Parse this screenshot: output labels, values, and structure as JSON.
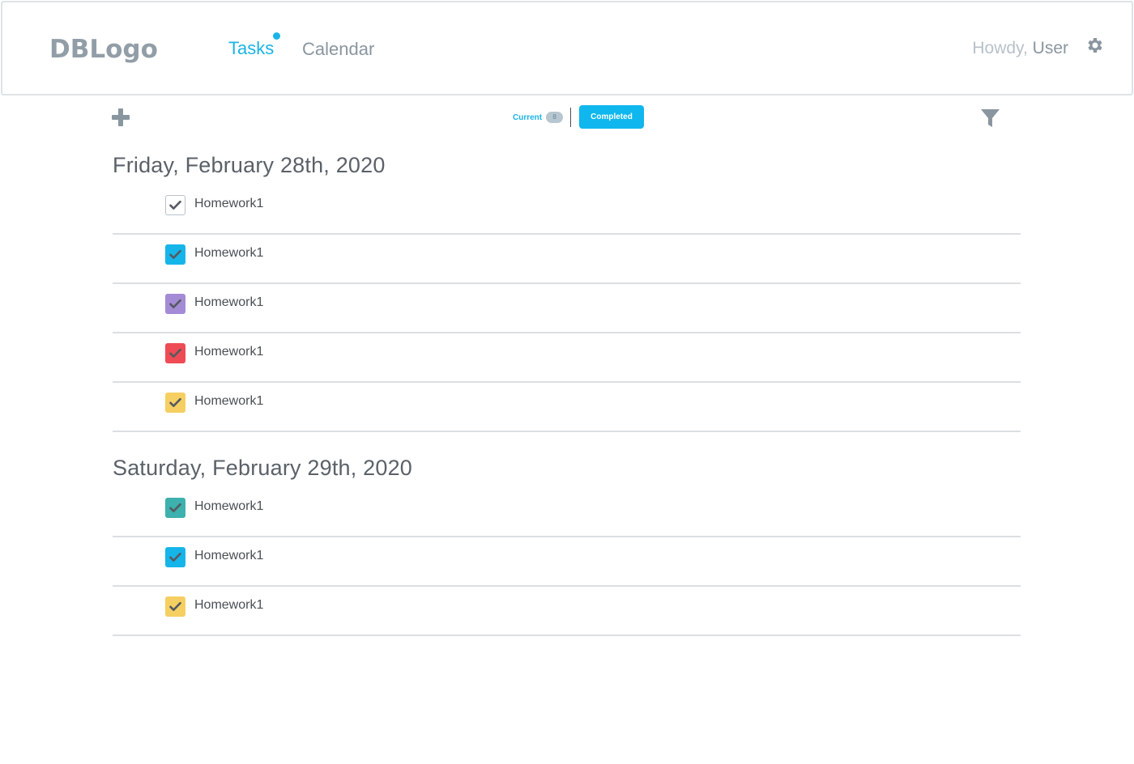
{
  "header": {
    "logo": "DBLogo",
    "nav": {
      "tasks": "Tasks",
      "calendar": "Calendar"
    },
    "greeting": {
      "howdy": "Howdy,",
      "user": "User"
    }
  },
  "toolbar": {
    "current_label": "Current",
    "current_count": "8",
    "completed_label": "Completed"
  },
  "groups": [
    {
      "date": "Friday, February 28th, 2020",
      "tasks": [
        {
          "label": "Homework1",
          "color": "#ffffff"
        },
        {
          "label": "Homework1",
          "color": "#15b5ea"
        },
        {
          "label": "Homework1",
          "color": "#a48bd6"
        },
        {
          "label": "Homework1",
          "color": "#ef4b55"
        },
        {
          "label": "Homework1",
          "color": "#f6cf63"
        }
      ]
    },
    {
      "date": "Saturday, February 29th, 2020",
      "tasks": [
        {
          "label": "Homework1",
          "color": "#3cb1ad"
        },
        {
          "label": "Homework1",
          "color": "#15b5ea"
        },
        {
          "label": "Homework1",
          "color": "#f6cf63"
        }
      ]
    }
  ],
  "icons": {
    "add": "plus-icon",
    "filter": "filter-icon",
    "settings": "gear-icon",
    "check": "checkmark-icon"
  }
}
